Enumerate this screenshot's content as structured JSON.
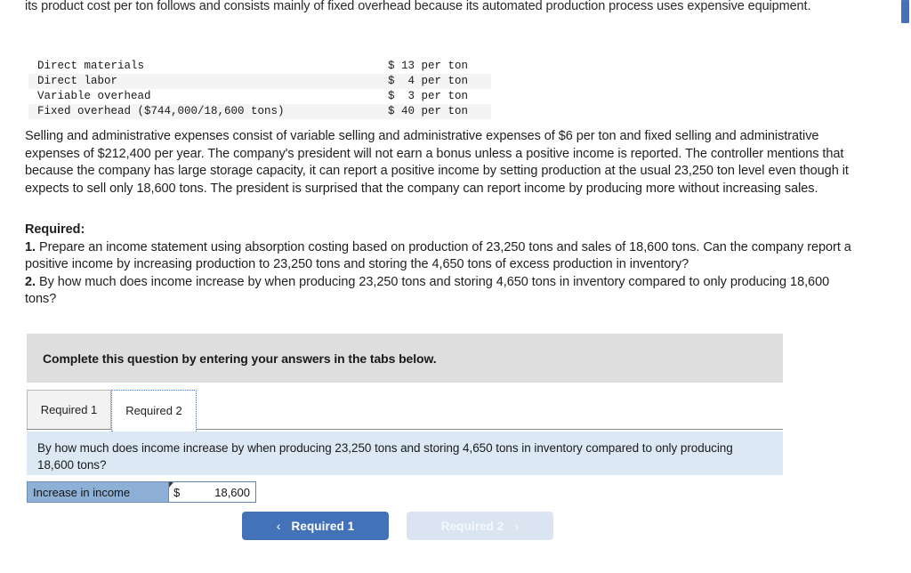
{
  "intro": {
    "paragraph": "its product cost per ton follows and consists mainly of fixed overhead because its automated production process uses expensive equipment."
  },
  "cost_table": {
    "rows": [
      {
        "label": "Direct materials",
        "amount": "$ 13 per ton"
      },
      {
        "label": "Direct labor",
        "amount": "$  4 per ton"
      },
      {
        "label": "Variable overhead",
        "amount": "$  3 per ton"
      },
      {
        "label": "Fixed overhead ($744,000/18,600 tons)",
        "amount": "$ 40 per ton"
      }
    ]
  },
  "selling_admin_paragraph": "Selling and administrative expenses consist of variable selling and administrative expenses of $6 per ton and fixed selling and administrative expenses of $212,400 per year. The company's president will not earn a bonus unless a positive income is reported. The controller mentions that because the company has large storage capacity, it can report a positive income by setting production at the usual 23,250 ton level even though it expects to sell only 18,600 tons. The president is surprised that the company can report income by producing more without increasing sales.",
  "required": {
    "heading": "Required:",
    "item1_number": "1.",
    "item1_text": " Prepare an income statement using absorption costing based on production of 23,250 tons and sales of 18,600 tons. Can the company report a positive income by increasing production to 23,250 tons and storing the 4,650 tons of excess production in inventory?",
    "item2_number": "2.",
    "item2_text": " By how much does income increase by when producing 23,250 tons and storing 4,650 tons in inventory compared to only producing 18,600 tons?"
  },
  "instruction_banner": {
    "text": "Complete this question by entering your answers in the tabs below."
  },
  "tabs": [
    {
      "label": "Required 1",
      "active": false
    },
    {
      "label": "Required 2",
      "active": true
    }
  ],
  "question_panel": {
    "text": "By how much does income increase by when producing 23,250 tons and storing 4,650 tons in inventory compared to only producing 18,600 tons?"
  },
  "answer_row": {
    "label": "Increase in income",
    "currency": "$",
    "value": "18,600"
  },
  "nav": {
    "prev_label": "Required 1",
    "prev_icon": "chevron-left-icon",
    "prev_chevron": "‹",
    "next_label": "Required 2",
    "next_icon": "chevron-right-icon",
    "next_chevron": "›"
  },
  "colors": {
    "accent_blue": "#4472b8",
    "panel_blue": "#dce9f5",
    "banner_gray": "#dedede",
    "label_blue": "#8eb0d6",
    "next_disabled": "#dbe5f1",
    "tab_inactive": "#f2f2f2",
    "table_alt_row": "#f4f4f4"
  }
}
